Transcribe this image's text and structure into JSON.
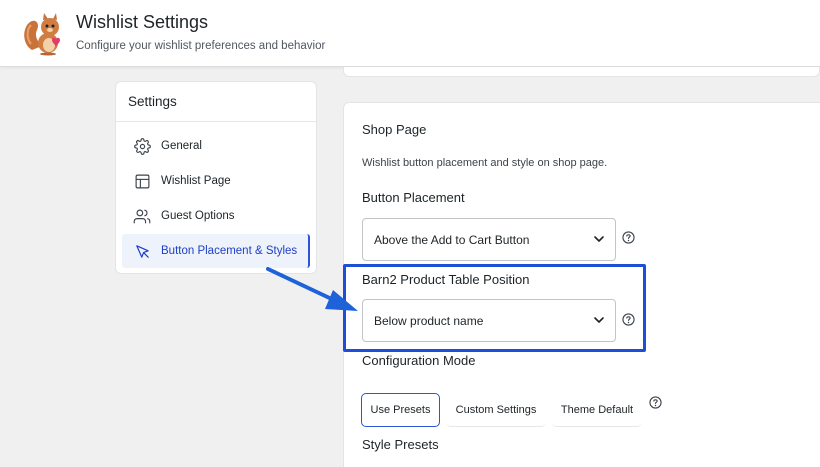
{
  "header": {
    "title": "Wishlist Settings",
    "subtitle": "Configure your wishlist preferences and behavior"
  },
  "sidebar": {
    "title": "Settings",
    "items": [
      {
        "label": "General",
        "icon": "gear-icon"
      },
      {
        "label": "Wishlist Page",
        "icon": "layout-icon"
      },
      {
        "label": "Guest Options",
        "icon": "users-icon"
      },
      {
        "label": "Button Placement & Styles",
        "icon": "cursor-icon",
        "active": true
      }
    ]
  },
  "main": {
    "shop_page": {
      "title": "Shop Page",
      "description": "Wishlist button placement and style on shop page."
    },
    "button_placement": {
      "label": "Button Placement",
      "value": "Above the Add to Cart Button"
    },
    "barn2_position": {
      "label": "Barn2 Product Table Position",
      "value": "Below product name"
    },
    "configuration_mode": {
      "label": "Configuration Mode",
      "tabs": [
        "Use Presets",
        "Custom Settings",
        "Theme Default"
      ],
      "selected": "Use Presets"
    },
    "style_presets": {
      "label": "Style Presets"
    }
  },
  "colors": {
    "accent": "#2f54d6",
    "highlight": "#1d4ed8",
    "arrow": "#1d62d8"
  }
}
